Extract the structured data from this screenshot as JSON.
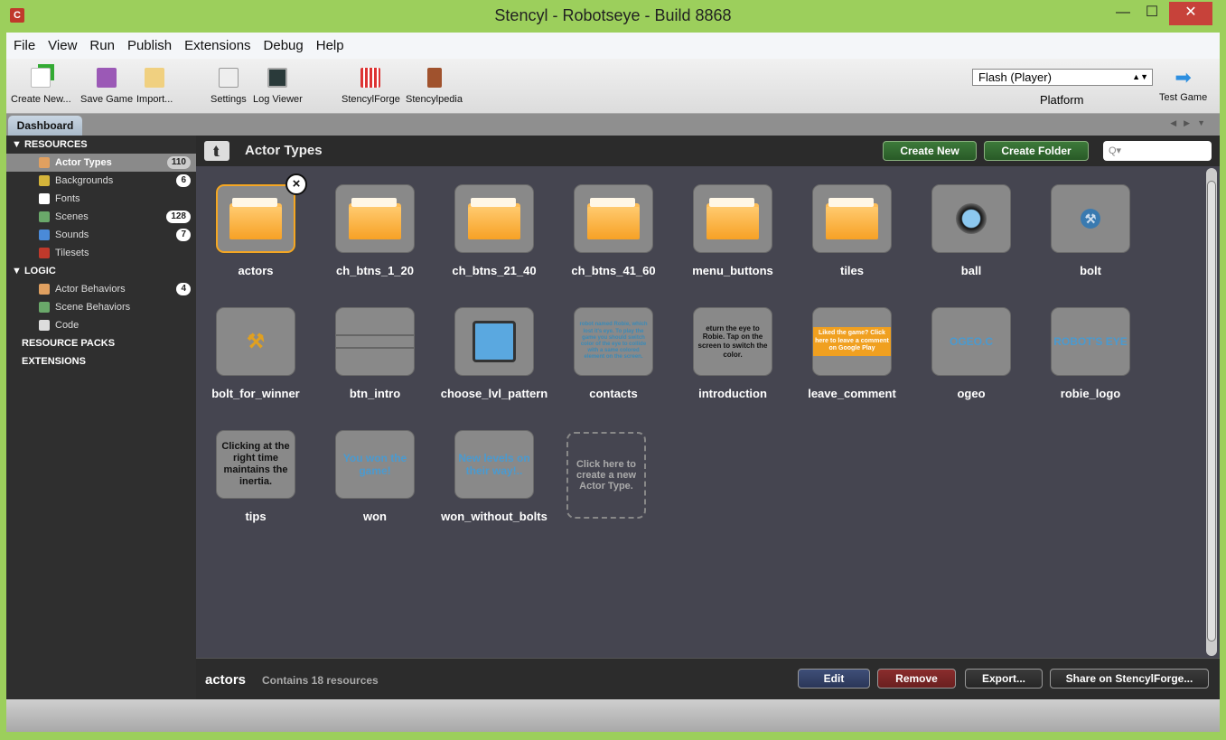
{
  "window": {
    "title": "Stencyl - Robotseye - Build 8868",
    "app_icon": "C",
    "minimize": "—",
    "maximize": "☐",
    "close": "✕"
  },
  "menu": [
    "File",
    "View",
    "Run",
    "Publish",
    "Extensions",
    "Debug",
    "Help"
  ],
  "toolbar": {
    "create_new": "Create New...",
    "save_game": "Save Game",
    "import": "Import...",
    "settings": "Settings",
    "log_viewer": "Log Viewer",
    "stencylforge": "StencylForge",
    "stencylpedia": "Stencylpedia",
    "platform_value": "Flash (Player)",
    "platform_label": "Platform",
    "test_game": "Test Game"
  },
  "tabs": {
    "dashboard": "Dashboard"
  },
  "sidebar": {
    "resources_header": "▼ RESOURCES",
    "resources": [
      {
        "label": "Actor Types",
        "count": "110",
        "icon": "actor-icon",
        "color": "#e0a060"
      },
      {
        "label": "Backgrounds",
        "count": "6",
        "icon": "background-icon",
        "color": "#d4b43a"
      },
      {
        "label": "Fonts",
        "count": "",
        "icon": "font-icon",
        "color": "#ffffff"
      },
      {
        "label": "Scenes",
        "count": "128",
        "icon": "scene-icon",
        "color": "#6aa86a"
      },
      {
        "label": "Sounds",
        "count": "7",
        "icon": "sound-icon",
        "color": "#4a8ad8"
      },
      {
        "label": "Tilesets",
        "count": "",
        "icon": "tileset-icon",
        "color": "#c0392b"
      }
    ],
    "logic_header": "▼ LOGIC",
    "logic": [
      {
        "label": "Actor Behaviors",
        "count": "4",
        "icon": "actor-behavior-icon",
        "color": "#e0a060"
      },
      {
        "label": "Scene Behaviors",
        "count": "",
        "icon": "scene-behavior-icon",
        "color": "#6aa86a"
      },
      {
        "label": "Code",
        "count": "",
        "icon": "code-icon",
        "color": "#dddddd"
      }
    ],
    "resource_packs": "RESOURCE PACKS",
    "extensions": "EXTENSIONS"
  },
  "main": {
    "title": "Actor Types",
    "create_new": "Create New",
    "create_folder": "Create Folder",
    "search_placeholder": "Q▾",
    "items": [
      {
        "label": "actors",
        "kind": "folder"
      },
      {
        "label": "ch_btns_1_20",
        "kind": "folder"
      },
      {
        "label": "ch_btns_21_40",
        "kind": "folder"
      },
      {
        "label": "ch_btns_41_60",
        "kind": "folder"
      },
      {
        "label": "menu_buttons",
        "kind": "folder"
      },
      {
        "label": "tiles",
        "kind": "folder"
      },
      {
        "label": "ball",
        "kind": "ball"
      },
      {
        "label": "bolt",
        "kind": "bolt"
      },
      {
        "label": "bolt_for_winner",
        "kind": "bolt2"
      },
      {
        "label": "btn_intro",
        "kind": "lines"
      },
      {
        "label": "choose_lvl_pattern",
        "kind": "square"
      },
      {
        "label": "contacts",
        "kind": "text",
        "text": "robot named Robie, which lost it's eye. To play the game you should switch color of the eye to collide with a same colored element on the screen."
      },
      {
        "label": "introduction",
        "kind": "text",
        "text": "eturn the eye to Robie. Tap on the screen to switch the color."
      },
      {
        "label": "leave_comment",
        "kind": "banner",
        "text": "Liked the game? Click here to leave a comment on Google Play"
      },
      {
        "label": "ogeo",
        "kind": "logo",
        "text": "OGEO.C"
      },
      {
        "label": "robie_logo",
        "kind": "logo",
        "text": "ROBOT'S EYE"
      },
      {
        "label": "tips",
        "kind": "text",
        "text": "Clicking at the right time maintains the inertia."
      },
      {
        "label": "won",
        "kind": "logo",
        "text": "You won the game!"
      },
      {
        "label": "won_without_bolts",
        "kind": "logo",
        "text": "New levels on their way!.."
      }
    ],
    "new_tile": "Click here to create a new Actor Type."
  },
  "footer": {
    "name": "actors",
    "info": "Contains 18 resources",
    "edit": "Edit",
    "remove": "Remove",
    "export": "Export...",
    "share": "Share on StencylForge..."
  }
}
